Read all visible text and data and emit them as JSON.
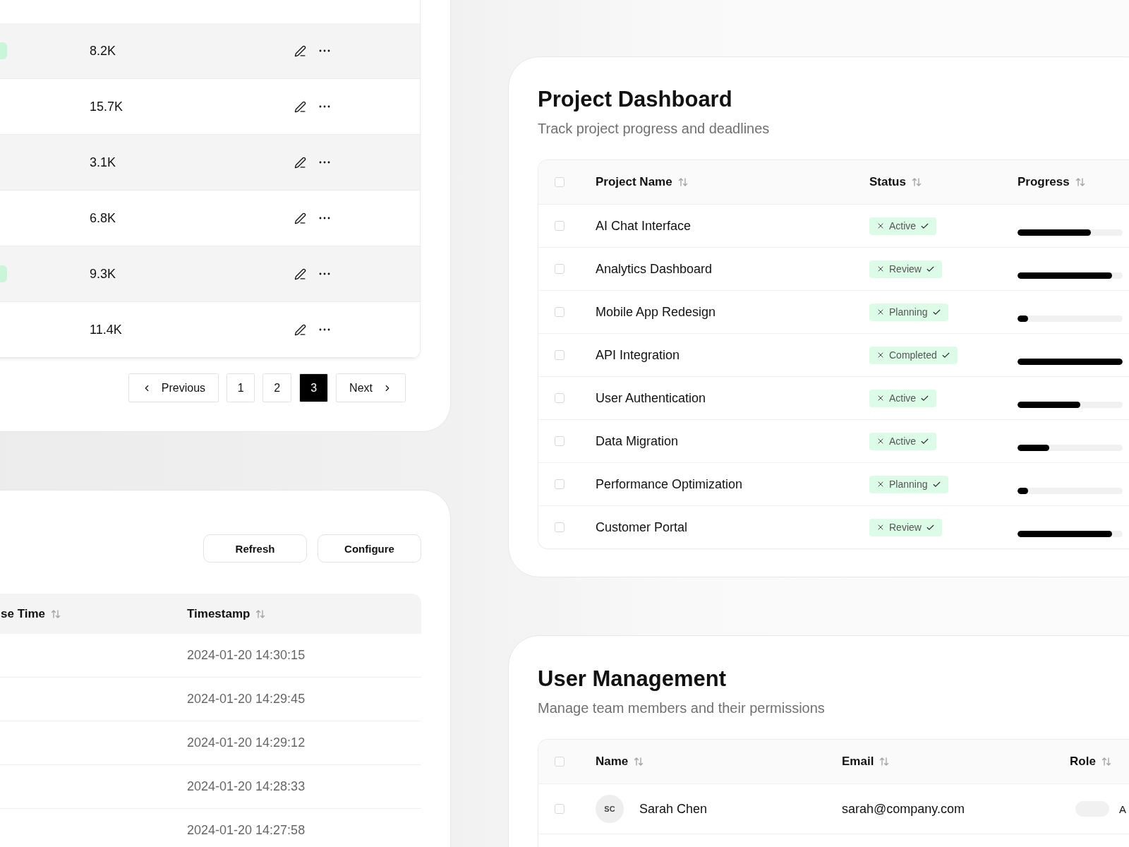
{
  "metrics_table": {
    "rows": [
      {
        "badge": true,
        "value": "8.2K"
      },
      {
        "badge": false,
        "value": "15.7K"
      },
      {
        "badge": false,
        "value": "3.1K"
      },
      {
        "badge": false,
        "value": "6.8K"
      },
      {
        "badge": true,
        "value": "9.3K"
      },
      {
        "badge": false,
        "value": "11.4K"
      }
    ],
    "pagination": {
      "previous": "Previous",
      "next": "Next",
      "pages": [
        {
          "label": "1",
          "selected": false
        },
        {
          "label": "2",
          "selected": false
        },
        {
          "label": "3",
          "selected": true
        }
      ]
    }
  },
  "log_panel": {
    "buttons": [
      "Refresh",
      "Configure"
    ],
    "columns": [
      "se Time",
      "Timestamp"
    ],
    "rows": [
      "2024-01-20 14:30:15",
      "2024-01-20 14:29:45",
      "2024-01-20 14:29:12",
      "2024-01-20 14:28:33",
      "2024-01-20 14:27:58"
    ]
  },
  "project_dashboard": {
    "title": "Project Dashboard",
    "subtitle": "Track project progress and deadlines",
    "select_all_checked": false,
    "columns": [
      "Project Name",
      "Status",
      "Progress"
    ],
    "rows": [
      {
        "checked": false,
        "name": "AI Chat Interface",
        "status": "Active",
        "level": 0.7
      },
      {
        "checked": false,
        "name": "Analytics Dashboard",
        "status": "Review",
        "level": 0.9
      },
      {
        "checked": false,
        "name": "Mobile App Redesign",
        "status": "Planning",
        "level": 0.1
      },
      {
        "checked": false,
        "name": "API Integration",
        "status": "Completed",
        "level": 1.0
      },
      {
        "checked": false,
        "name": "User Authentication",
        "status": "Active",
        "level": 0.6
      },
      {
        "checked": false,
        "name": "Data Migration",
        "status": "Active",
        "level": 0.3
      },
      {
        "checked": false,
        "name": "Performance Optimization",
        "status": "Planning",
        "level": 0.1
      },
      {
        "checked": false,
        "name": "Customer Portal",
        "status": "Review",
        "level": 0.9
      }
    ]
  },
  "user_management": {
    "title": "User Management",
    "subtitle": "Manage team members and their permissions",
    "select_all_checked": false,
    "columns": [
      "Name",
      "Email",
      "Role"
    ],
    "rows": [
      {
        "checked": false,
        "initials": "SC",
        "name": "Sarah Chen",
        "email": "sarah@company.com",
        "role": "A"
      }
    ]
  }
}
